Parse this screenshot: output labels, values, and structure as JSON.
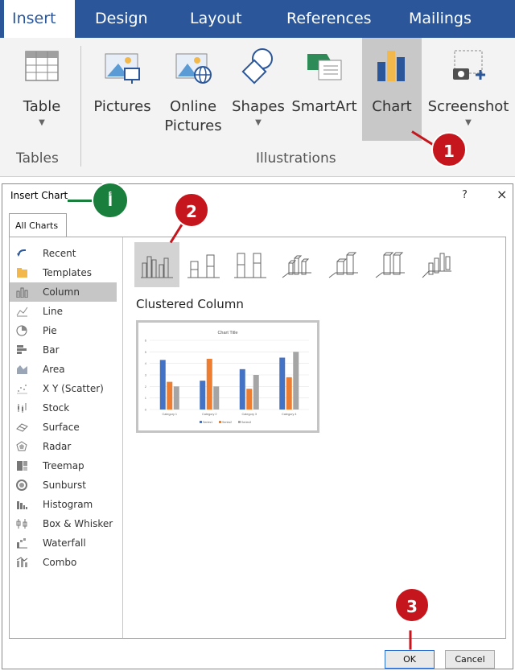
{
  "ribbon": {
    "tabs": [
      "Insert",
      "Design",
      "Layout",
      "References",
      "Mailings"
    ],
    "buttons": {
      "table": {
        "label": "Table",
        "icon": "table-icon"
      },
      "pictures": {
        "label": "Pictures",
        "icon": "pictures-icon"
      },
      "online_pictures": {
        "label1": "Online",
        "label2": "Pictures",
        "icon": "online-pictures-icon"
      },
      "shapes": {
        "label": "Shapes",
        "icon": "shapes-icon"
      },
      "smartart": {
        "label": "SmartArt",
        "icon": "smartart-icon"
      },
      "chart": {
        "label": "Chart",
        "icon": "chart-icon"
      },
      "screenshot": {
        "label": "Screenshot",
        "icon": "screenshot-icon"
      }
    },
    "groups": {
      "tables": "Tables",
      "illustrations": "Illustrations"
    }
  },
  "dialog": {
    "title": "Insert Chart",
    "help": "?",
    "close": "×",
    "tab": "All Charts",
    "categories": [
      {
        "label": "Recent",
        "icon": "recent-icon"
      },
      {
        "label": "Templates",
        "icon": "templates-icon"
      },
      {
        "label": "Column",
        "icon": "column-icon"
      },
      {
        "label": "Line",
        "icon": "line-icon"
      },
      {
        "label": "Pie",
        "icon": "pie-icon"
      },
      {
        "label": "Bar",
        "icon": "bar-icon"
      },
      {
        "label": "Area",
        "icon": "area-icon"
      },
      {
        "label": "X Y (Scatter)",
        "icon": "scatter-icon"
      },
      {
        "label": "Stock",
        "icon": "stock-icon"
      },
      {
        "label": "Surface",
        "icon": "surface-icon"
      },
      {
        "label": "Radar",
        "icon": "radar-icon"
      },
      {
        "label": "Treemap",
        "icon": "treemap-icon"
      },
      {
        "label": "Sunburst",
        "icon": "sunburst-icon"
      },
      {
        "label": "Histogram",
        "icon": "histogram-icon"
      },
      {
        "label": "Box & Whisker",
        "icon": "box-whisker-icon"
      },
      {
        "label": "Waterfall",
        "icon": "waterfall-icon"
      },
      {
        "label": "Combo",
        "icon": "combo-icon"
      }
    ],
    "selected_category": "Column",
    "subtype_title": "Clustered Column",
    "preview": {
      "title": "Chart Title",
      "categories": [
        "Category 1",
        "Category 2",
        "Category 3",
        "Category 4"
      ],
      "series": [
        {
          "name": "Series1",
          "color": "#4472c4",
          "values": [
            4.3,
            2.5,
            3.5,
            4.5
          ]
        },
        {
          "name": "Series2",
          "color": "#ed7d31",
          "values": [
            2.4,
            4.4,
            1.8,
            2.8
          ]
        },
        {
          "name": "Series3",
          "color": "#a5a5a5",
          "values": [
            2,
            2,
            3,
            5
          ]
        }
      ],
      "ylim": [
        0,
        6
      ],
      "yticks": [
        "0",
        "1",
        "2",
        "3",
        "4",
        "5",
        "6"
      ]
    },
    "ok": "OK",
    "cancel": "Cancel"
  },
  "markers": {
    "one": "1",
    "two": "2",
    "three": "3",
    "a": "أ"
  },
  "colors": {
    "ribbon_tab": "#2b579a",
    "marker_red": "#c4161c",
    "marker_green": "#1a7f3c"
  }
}
